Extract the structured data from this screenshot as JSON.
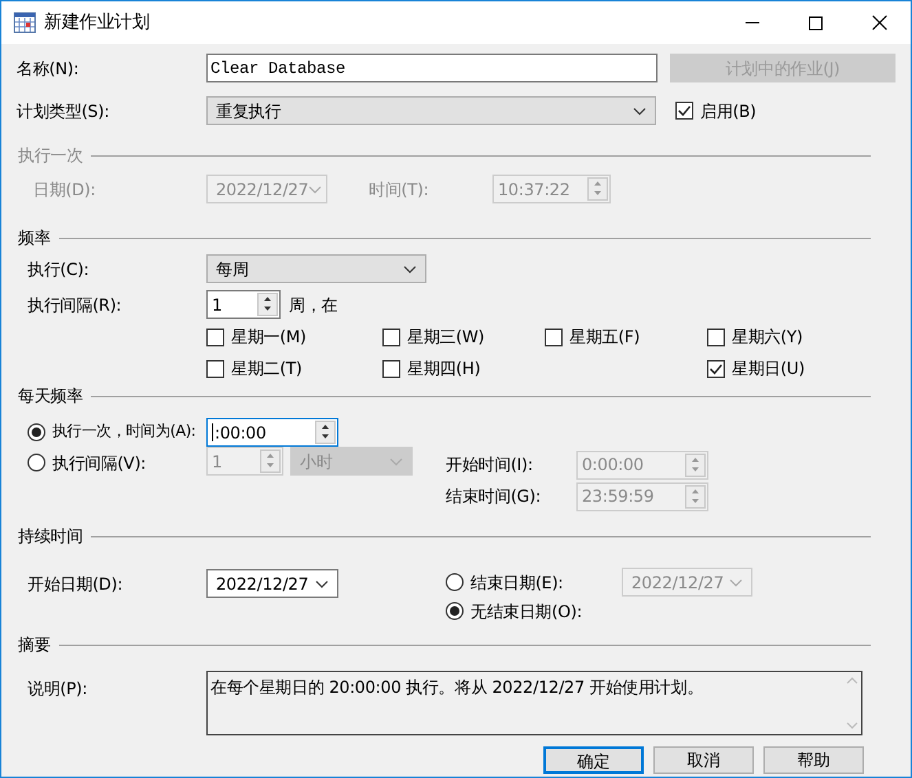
{
  "window": {
    "title": "新建作业计划"
  },
  "name": {
    "label": "名称(N):",
    "value": "Clear Database"
  },
  "jobs_button": {
    "label": "计划中的作业(J)",
    "disabled": true
  },
  "schedule_type": {
    "label": "计划类型(S):",
    "value": "重复执行"
  },
  "enabled": {
    "label": "启用(B)",
    "checked": true
  },
  "one_time": {
    "title": "执行一次",
    "disabled": true,
    "date_label": "日期(D):",
    "date": "2022/12/27",
    "time_label": "时间(T):",
    "time": "10:37:22"
  },
  "frequency": {
    "title": "频率",
    "occurs_label": "执行(C):",
    "occurs": "每周",
    "recurs_label": "执行间隔(R):",
    "recurs": "1",
    "recurs_unit": "周，在",
    "days": [
      {
        "label": "星期一(M)",
        "checked": false
      },
      {
        "label": "星期二(T)",
        "checked": false
      },
      {
        "label": "星期三(W)",
        "checked": false
      },
      {
        "label": "星期四(H)",
        "checked": false
      },
      {
        "label": "星期五(F)",
        "checked": false
      },
      {
        "label": "星期六(Y)",
        "checked": false
      },
      {
        "label": "星期日(U)",
        "checked": true
      }
    ]
  },
  "daily_frequency": {
    "title": "每天频率",
    "options": [
      {
        "kind": "once",
        "label": "执行一次，时间为(A):",
        "selected": true,
        "value": ":00:00"
      },
      {
        "kind": "every",
        "label": "执行间隔(V):",
        "selected": false,
        "value": "1",
        "unit": "小时"
      }
    ],
    "start_label": "开始时间(I):",
    "start": "0:00:00",
    "end_label": "结束时间(G):",
    "end": "23:59:59"
  },
  "duration": {
    "title": "持续时间",
    "start_label": "开始日期(D):",
    "start": "2022/12/27",
    "end_options": [
      {
        "kind": "end_date",
        "label": "结束日期(E):",
        "selected": false,
        "value": "2022/12/27"
      },
      {
        "kind": "no_end",
        "label": "无结束日期(O):",
        "selected": true
      }
    ]
  },
  "summary": {
    "title": "摘要",
    "label": "说明(P):",
    "text": "在每个星期日的 20:00:00 执行。将从 2022/12/27 开始使用计划。"
  },
  "buttons": [
    {
      "label": "确定",
      "default": true
    },
    {
      "label": "取消",
      "default": false
    },
    {
      "label": "帮助",
      "default": false
    }
  ]
}
